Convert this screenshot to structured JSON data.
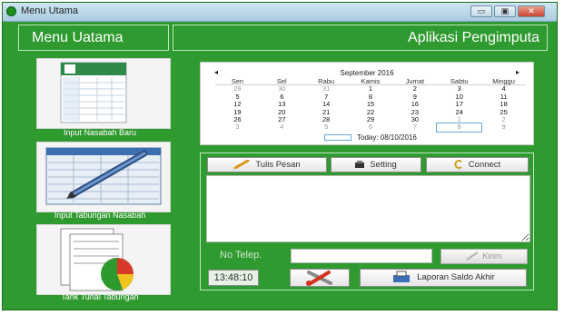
{
  "window": {
    "title": "Menu Utama",
    "minimize_glyph": "▭",
    "maximize_glyph": "▣",
    "close_glyph": "✕"
  },
  "header": {
    "left_title": "Menu Uatama",
    "right_title": "Aplikasi Pengimputa"
  },
  "sidebar": {
    "items": [
      {
        "label": "Input Nasabah Baru",
        "icon": "spreadsheet-document-icon"
      },
      {
        "label": "Input Tabungan Nasabah",
        "icon": "pen-ledger-icon"
      },
      {
        "label": "Tarik Tunai Tabungan",
        "icon": "pie-chart-report-icon"
      }
    ]
  },
  "calendar": {
    "month_label": "September 2016",
    "prev_glyph": "◂",
    "next_glyph": "▸",
    "day_headers": [
      "Sen",
      "Sel",
      "Rabu",
      "Kamis",
      "Jumat",
      "Sabtu",
      "Minggu"
    ],
    "weeks": [
      [
        "29",
        "30",
        "31",
        "1",
        "2",
        "3",
        "4"
      ],
      [
        "5",
        "6",
        "7",
        "8",
        "9",
        "10",
        "11"
      ],
      [
        "12",
        "13",
        "14",
        "15",
        "16",
        "17",
        "18"
      ],
      [
        "19",
        "20",
        "21",
        "22",
        "23",
        "24",
        "25"
      ],
      [
        "26",
        "27",
        "28",
        "29",
        "30",
        "1",
        "2"
      ],
      [
        "3",
        "4",
        "5",
        "6",
        "7",
        "8",
        "9"
      ]
    ],
    "today_text": "Today: 08/10/2016"
  },
  "tools": {
    "tulis_pesan": "Tulis Pesan",
    "setting": "Setting",
    "connect": "Connect"
  },
  "sms": {
    "phone_label": "No Telep.",
    "phone_value": "",
    "send_label": "Kirim"
  },
  "footer": {
    "clock": "13:48:10",
    "report_label": "Laporan Saldo Akhir"
  },
  "colors": {
    "window_green": "#2f9a2f",
    "accent_blue": "#6aa7d8"
  }
}
